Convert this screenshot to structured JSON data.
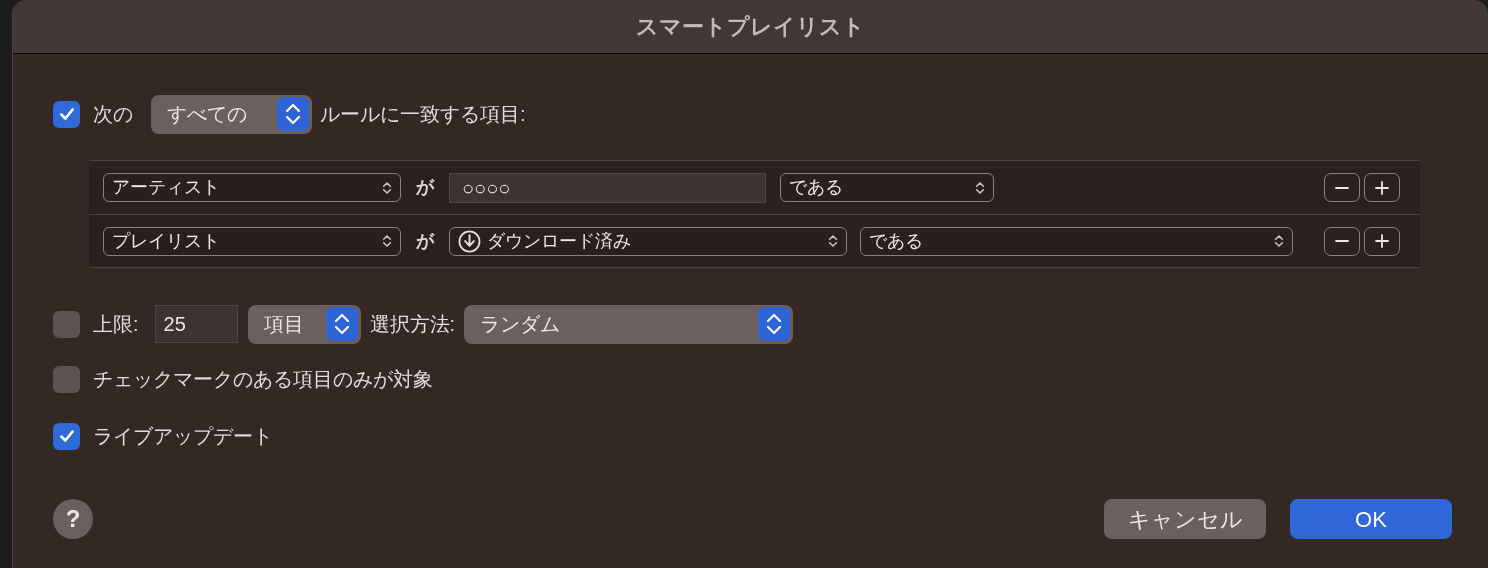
{
  "window": {
    "title": "スマートプレイリスト"
  },
  "match": {
    "checked": true,
    "prefix": "次の",
    "quantifier": "すべての",
    "suffix": "ルールに一致する項目:"
  },
  "rules": [
    {
      "field": "アーティスト",
      "verb": "が",
      "kind": "text",
      "value": "○○○○",
      "operator": "である"
    },
    {
      "field": "プレイリスト",
      "verb": "が",
      "kind": "playlist",
      "value": "ダウンロード済み",
      "operator": "である"
    }
  ],
  "limit": {
    "checked": false,
    "label": "上限:",
    "value": "25",
    "unit": "項目",
    "method_label": "選択方法:",
    "method": "ランダム"
  },
  "options": [
    {
      "label": "チェックマークのある項目のみが対象",
      "checked": false
    },
    {
      "label": "ライブアップデート",
      "checked": true
    }
  ],
  "help": "?",
  "buttons": [
    {
      "label": "キャンセル",
      "kind": "secondary"
    },
    {
      "label": "OK",
      "kind": "default"
    }
  ]
}
